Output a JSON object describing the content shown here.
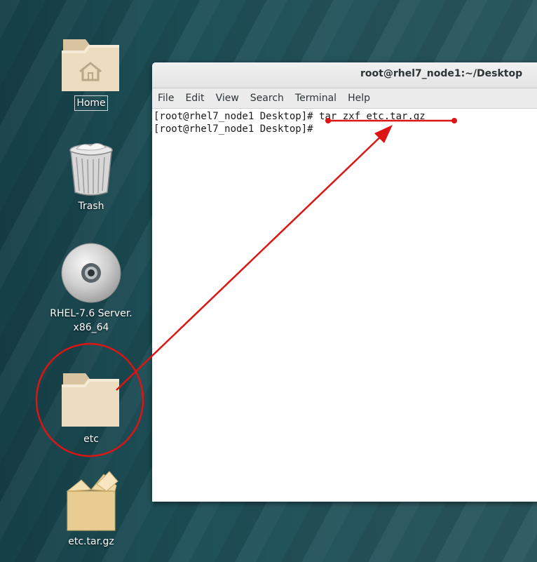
{
  "desktop": {
    "icons": [
      {
        "name": "Home",
        "icon": "home-folder-icon"
      },
      {
        "name": "Trash",
        "icon": "trash-icon"
      },
      {
        "name": "RHEL-7.6 Server.",
        "name_line2": "x86_64",
        "icon": "optical-disc-icon"
      },
      {
        "name": "etc",
        "icon": "folder-icon"
      },
      {
        "name": "etc.tar.gz",
        "icon": "archive-box-icon"
      }
    ]
  },
  "terminal": {
    "title": "root@rhel7_node1:~/Desktop",
    "menu": [
      "File",
      "Edit",
      "View",
      "Search",
      "Terminal",
      "Help"
    ],
    "lines": [
      {
        "prompt": "[root@rhel7_node1 Desktop]# ",
        "command": "tar zxf etc.tar.gz"
      },
      {
        "prompt": "[root@rhel7_node1 Desktop]# ",
        "command": ""
      }
    ]
  },
  "annotations": {
    "color": "#dd1414"
  },
  "colors": {
    "folder": "#e8d4b4",
    "annotation": "#dd1414"
  }
}
